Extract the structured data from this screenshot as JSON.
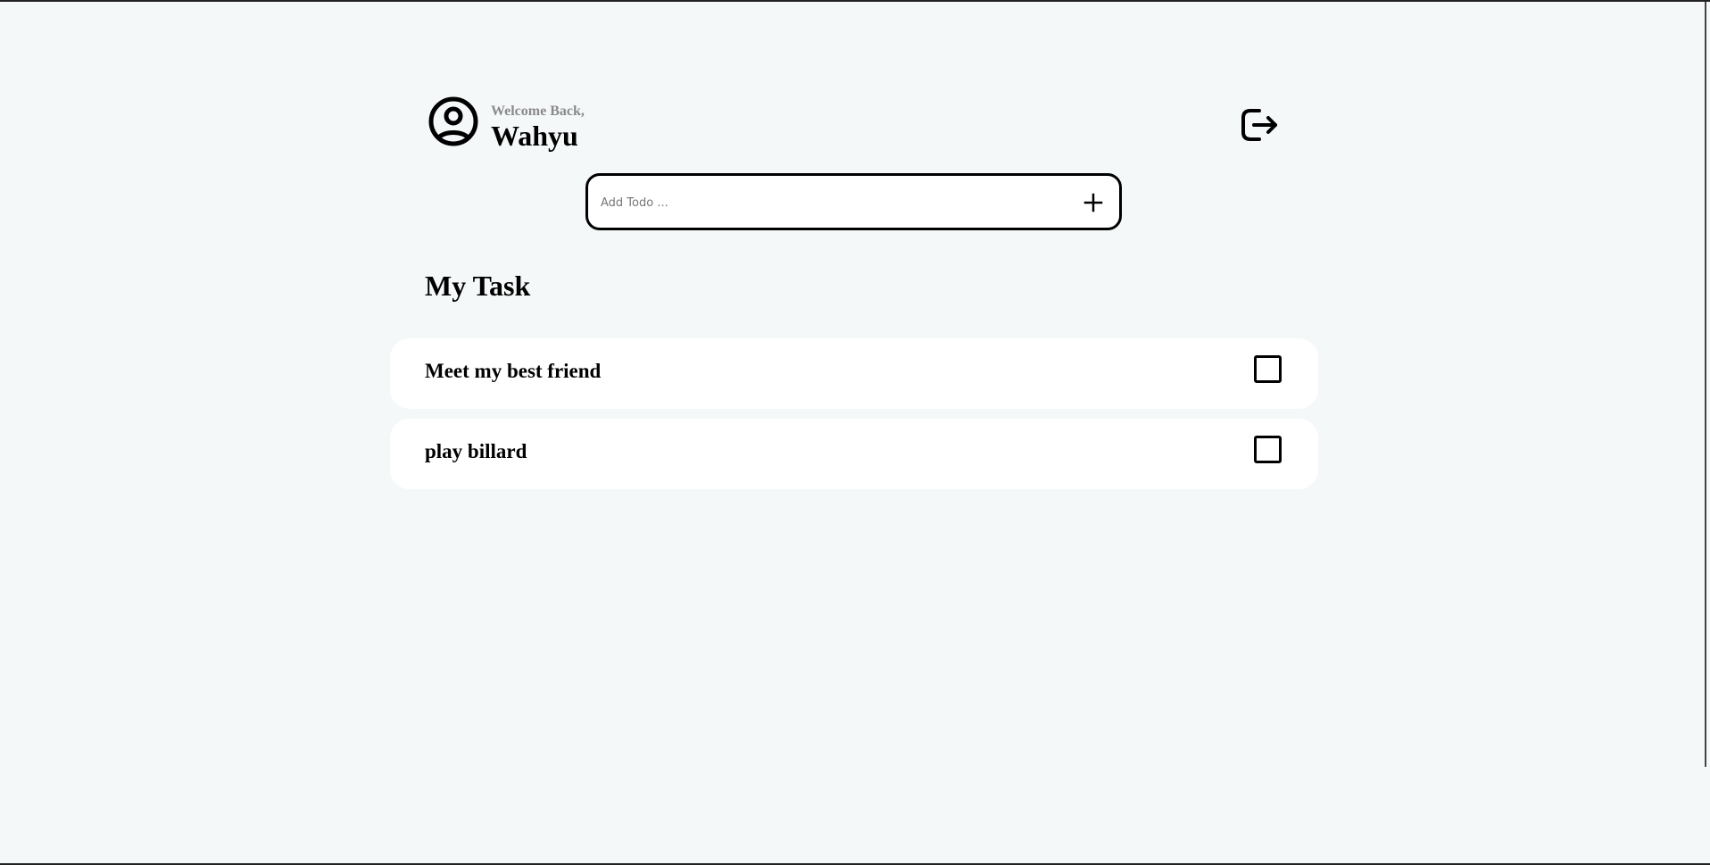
{
  "header": {
    "welcome_text": "Welcome Back,",
    "username": "Wahyu",
    "avatar_icon": "user-circle-icon",
    "logout_icon": "logout-icon"
  },
  "add_todo": {
    "placeholder": "Add Todo ...",
    "value": "",
    "add_icon": "plus-icon"
  },
  "tasks_section": {
    "title": "My Task",
    "items": [
      {
        "text": "Meet my best friend",
        "checked": false
      },
      {
        "text": "play billard",
        "checked": false
      }
    ]
  }
}
